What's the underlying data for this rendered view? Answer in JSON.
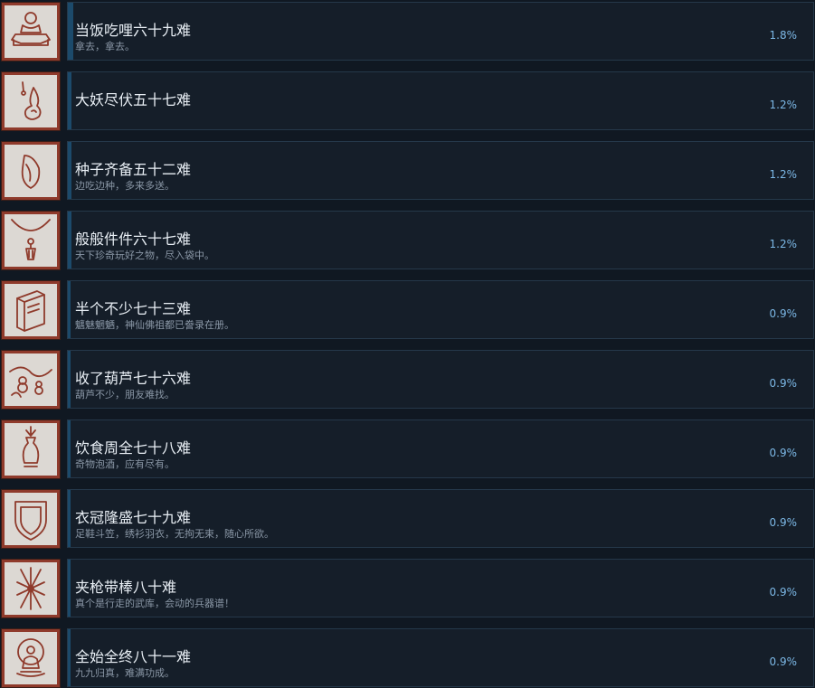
{
  "achievements": [
    {
      "name": "当饭吃哩六十九难",
      "desc": "拿去，拿去。",
      "percent": "1.8%",
      "progress": 0.018,
      "icon": "mortar-icon"
    },
    {
      "name": "大妖尽伏五十七难",
      "desc": "",
      "percent": "1.2%",
      "progress": 0.012,
      "icon": "gourd-flame-icon"
    },
    {
      "name": "种子齐备五十二难",
      "desc": "边吃边种，多来多送。",
      "percent": "1.2%",
      "progress": 0.012,
      "icon": "seed-icon"
    },
    {
      "name": "般般件件六十七难",
      "desc": "天下珍奇玩好之物，尽入袋中。",
      "percent": "1.2%",
      "progress": 0.012,
      "icon": "pendant-necklace-icon"
    },
    {
      "name": "半个不少七十三难",
      "desc": "魑魅魍魉，神仙佛祖都已誊录在册。",
      "percent": "0.9%",
      "progress": 0.009,
      "icon": "book-icon"
    },
    {
      "name": "收了葫芦七十六难",
      "desc": "葫芦不少，朋友难找。",
      "percent": "0.9%",
      "progress": 0.009,
      "icon": "gourd-vine-icon"
    },
    {
      "name": "饮食周全七十八难",
      "desc": "奇物泡酒，应有尽有。",
      "percent": "0.9%",
      "progress": 0.009,
      "icon": "vase-icon"
    },
    {
      "name": "衣冠隆盛七十九难",
      "desc": "足鞋斗笠，绣衫羽衣，无拘无束，随心所欲。",
      "percent": "0.9%",
      "progress": 0.009,
      "icon": "shield-icon"
    },
    {
      "name": "夹枪带棒八十难",
      "desc": "真个是行走的武库，会动的兵器谱！",
      "percent": "0.9%",
      "progress": 0.009,
      "icon": "weapons-icon"
    },
    {
      "name": "全始全终八十一难",
      "desc": "九九归真，难满功成。",
      "percent": "0.9%",
      "progress": 0.009,
      "icon": "meditating-monk-icon"
    }
  ]
}
